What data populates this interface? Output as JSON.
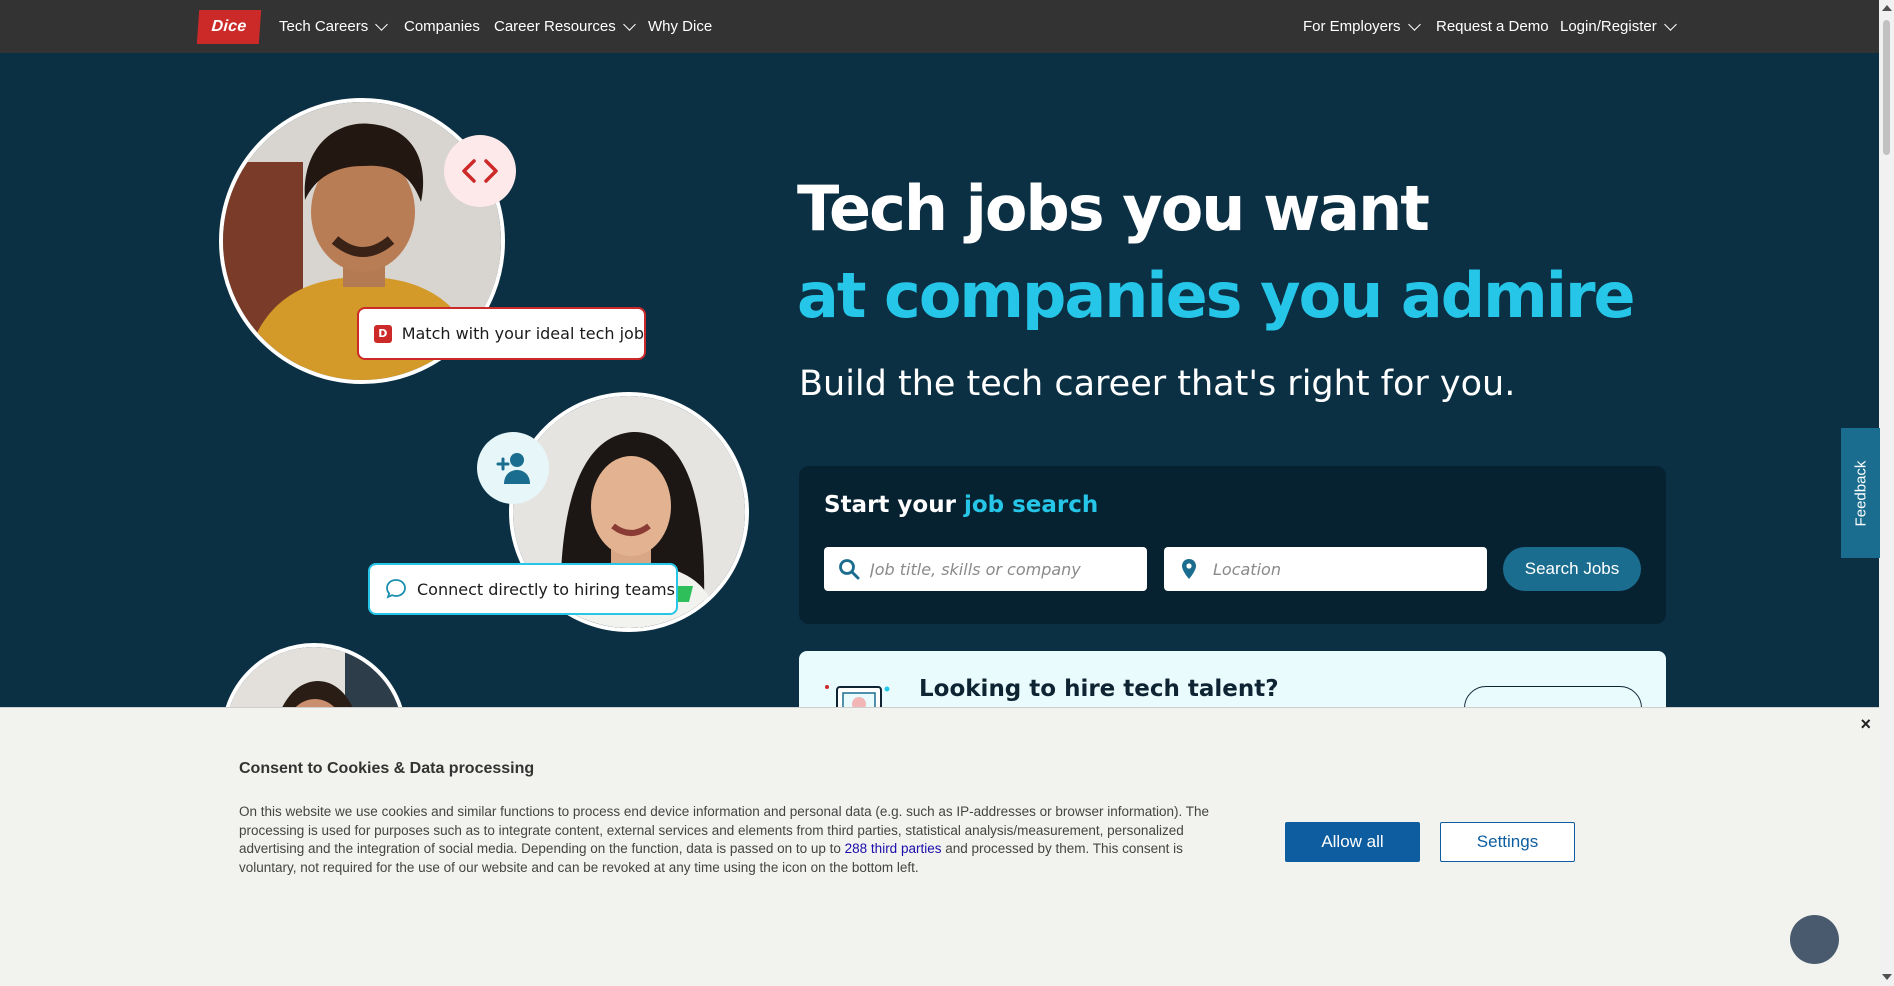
{
  "nav": {
    "logo": "Dice",
    "items_left": [
      "Tech Careers",
      "Companies",
      "Career Resources",
      "Why Dice"
    ],
    "items_right": [
      "For Employers",
      "Request a Demo",
      "Login/Register"
    ]
  },
  "hero": {
    "title_line1": "Tech jobs you want",
    "title_line2": "at companies you admire",
    "subtitle": "Build the tech career that's right for you."
  },
  "search": {
    "heading_prefix": "Start your ",
    "heading_accent": "job search",
    "keyword_placeholder": "Job title, skills or company",
    "location_placeholder": "Location",
    "button": "Search Jobs"
  },
  "hire": {
    "title": "Looking to hire tech talent?"
  },
  "photo_badges": {
    "match": "Match with your ideal tech job",
    "connect": "Connect directly to hiring teams"
  },
  "feedback": "Feedback",
  "cookie": {
    "title": "Consent to Cookies & Data processing",
    "body_1": "On this website we use cookies and similar functions to process end device information and personal data (e.g. such as IP-addresses or browser information). The processing is used for purposes such as to integrate content, external services and elements from third parties, statistical analysis/measurement, personalized advertising and the integration of social media. Depending on the function, data is passed on to up to ",
    "body_link": "288 third parties",
    "body_2": " and processed by them. This consent is voluntary, not required for the use of our website and can be revoked at any time using the icon on the bottom left.",
    "allow": "Allow all",
    "settings": "Settings",
    "close": "×"
  },
  "colors": {
    "nav_bg": "#333333",
    "hero_bg": "#0b3044",
    "accent_cyan": "#26c6e8",
    "brand_red": "#cc2929",
    "button_teal": "#1b6d8f",
    "consent_blue": "#0d5da0"
  }
}
